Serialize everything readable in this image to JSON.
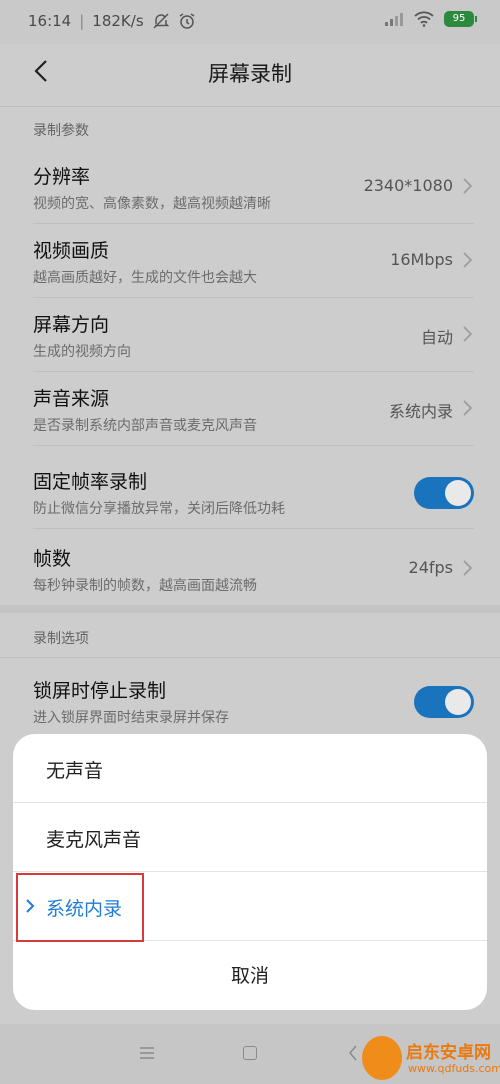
{
  "status_bar": {
    "time": "16:14",
    "speed": "182K/s",
    "battery": "95"
  },
  "header": {
    "title": "屏幕录制"
  },
  "sections": [
    {
      "label": "录制参数",
      "items": [
        {
          "title": "分辨率",
          "subtitle": "视频的宽、高像素数，越高视频越清晰",
          "value": "2340*1080"
        },
        {
          "title": "视频画质",
          "subtitle": "越高画质越好，生成的文件也会越大",
          "value": "16Mbps"
        },
        {
          "title": "屏幕方向",
          "subtitle": "生成的视频方向",
          "value": "自动"
        },
        {
          "title": "声音来源",
          "subtitle": "是否录制系统内部声音或麦克风声音",
          "value": "系统内录"
        },
        {
          "title": "固定帧率录制",
          "subtitle": "防止微信分享播放异常，关闭后降低功耗",
          "toggle": true
        },
        {
          "title": "帧数",
          "subtitle": "每秒钟录制的帧数，越高画面越流畅",
          "value": "24fps"
        }
      ]
    },
    {
      "label": "录制选项",
      "items": [
        {
          "title": "锁屏时停止录制",
          "subtitle": "进入锁屏界面时结束录屏并保存",
          "toggle": true
        }
      ]
    }
  ],
  "sheet": {
    "options": [
      "无声音",
      "麦克风声音",
      "系统内录"
    ],
    "selected": "系统内录",
    "cancel": "取消"
  },
  "watermark": {
    "name": "启东安卓网",
    "url": "www.qdfuds.com"
  },
  "colors": {
    "accent": "#1f7bd6",
    "toggle_on": "#1a73bd",
    "highlight_box": "#d63a3a"
  }
}
